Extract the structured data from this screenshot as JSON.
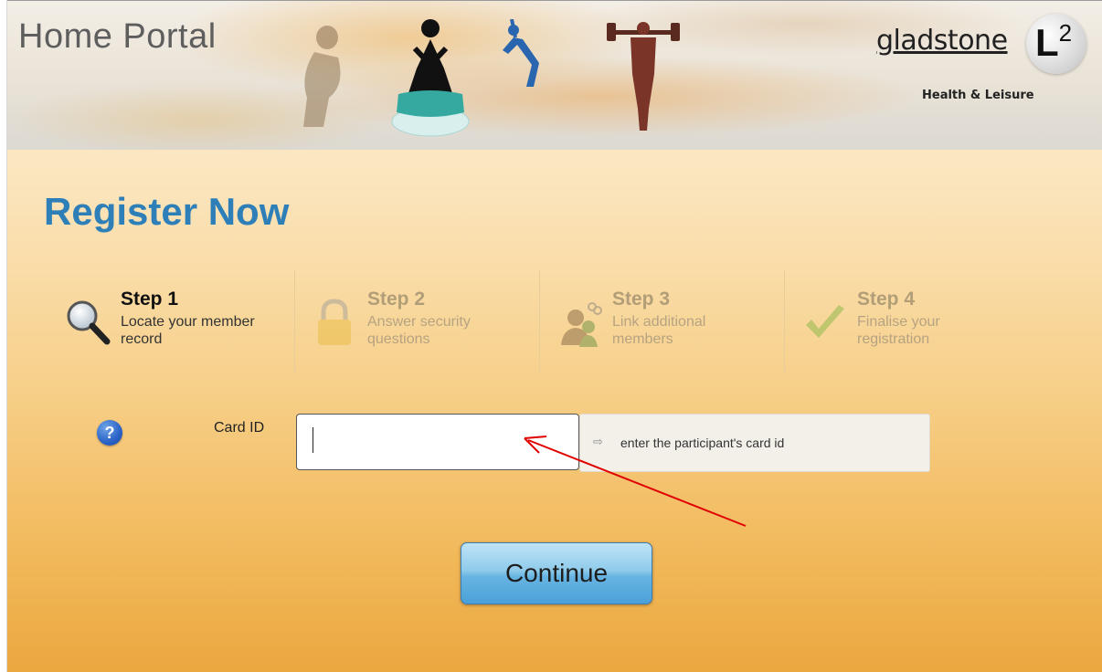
{
  "header": {
    "title": "Home Portal",
    "logo": {
      "name": "gladstone",
      "badge_letter": "L",
      "badge_sup": "2",
      "subtitle": "Health & Leisure"
    }
  },
  "page": {
    "title": "Register Now"
  },
  "steps": [
    {
      "title": "Step 1",
      "description": "Locate your member record",
      "icon": "magnifier-icon",
      "state": "active"
    },
    {
      "title": "Step 2",
      "description": "Answer security questions",
      "icon": "padlock-icon",
      "state": "inactive"
    },
    {
      "title": "Step 3",
      "description": "Link additional members",
      "icon": "link-members-icon",
      "state": "inactive"
    },
    {
      "title": "Step 4",
      "description": "Finalise your registration",
      "icon": "checkmark-icon",
      "state": "inactive"
    }
  ],
  "form": {
    "card_id_label": "Card ID",
    "card_id_value": "",
    "hint": "enter the participant's card id",
    "help_icon": "?",
    "continue_label": "Continue"
  },
  "colors": {
    "title_blue": "#2e7fb8",
    "annotation_red": "#e00000",
    "button_blue": "#67b4e2"
  }
}
